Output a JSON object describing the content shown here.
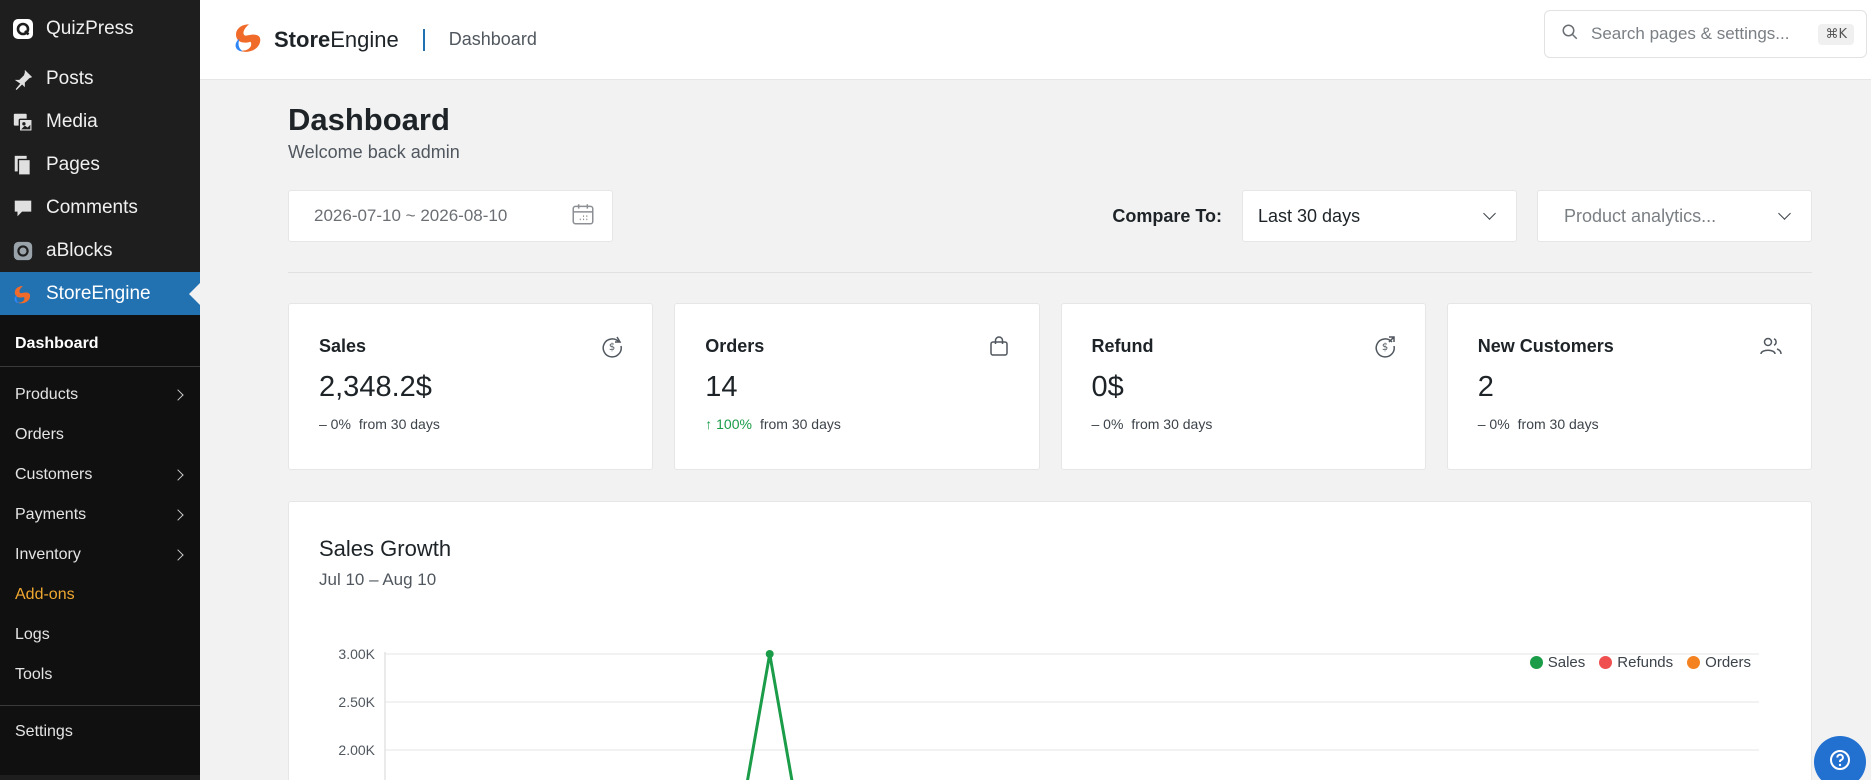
{
  "sidebar": {
    "top_items": [
      {
        "label": "QuizPress",
        "icon": "quizpress-icon"
      },
      {
        "label": "Posts",
        "icon": "pin-icon"
      },
      {
        "label": "Media",
        "icon": "media-icon"
      },
      {
        "label": "Pages",
        "icon": "pages-icon"
      },
      {
        "label": "Comments",
        "icon": "comment-icon"
      },
      {
        "label": "aBlocks",
        "icon": "ablocks-icon"
      },
      {
        "label": "StoreEngine",
        "icon": "storeengine-icon"
      }
    ],
    "submenu": [
      {
        "label": "Dashboard"
      },
      {
        "label": "Products"
      },
      {
        "label": "Orders"
      },
      {
        "label": "Customers"
      },
      {
        "label": "Payments"
      },
      {
        "label": "Inventory"
      },
      {
        "label": "Add-ons"
      },
      {
        "label": "Logs"
      },
      {
        "label": "Tools"
      },
      {
        "label": "Settings"
      }
    ]
  },
  "header": {
    "brand_bold": "Store",
    "brand_rest": "Engine",
    "crumb": "Dashboard",
    "search_placeholder": "Search pages & settings...",
    "search_shortcut": "⌘K"
  },
  "page": {
    "title": "Dashboard",
    "subtitle": "Welcome back admin"
  },
  "filters": {
    "date_range": "2026-07-10 ~ 2026-08-10",
    "compare_label": "Compare To:",
    "compare_value": "Last 30 days",
    "analytics_placeholder": "Product analytics..."
  },
  "stats": [
    {
      "title": "Sales",
      "value": "2,348.2$",
      "change": "– 0%",
      "period": "from 30 days",
      "icon": "dollar-refresh-icon"
    },
    {
      "title": "Orders",
      "value": "14",
      "change": "↑ 100%",
      "period": "from 30 days",
      "icon": "bag-icon"
    },
    {
      "title": "Refund",
      "value": "0$",
      "change": "– 0%",
      "period": "from 30 days",
      "icon": "dollar-return-icon"
    },
    {
      "title": "New Customers",
      "value": "2",
      "change": "– 0%",
      "period": "from 30 days",
      "icon": "users-icon"
    }
  ],
  "chart_card": {
    "title": "Sales Growth",
    "subtitle": "Jul 10 – Aug 10"
  },
  "chart_data": {
    "type": "line",
    "title": "Sales Growth",
    "subtitle": "Jul 10 – Aug 10",
    "ytick_labels": [
      "3.00K",
      "2.50K",
      "2.00K"
    ],
    "ylim_visible": [
      2000,
      3000
    ],
    "legend_position": "top-right",
    "grid": true,
    "series": [
      {
        "name": "Sales",
        "color": "#1a9c48",
        "peak_value": 3000,
        "peak_position_fraction": 0.28
      },
      {
        "name": "Refunds",
        "color": "#ef4f4f"
      },
      {
        "name": "Orders",
        "color": "#f58220"
      }
    ]
  },
  "colors": {
    "accent": "#2271b1",
    "sidebar_bg": "#1e1e1e",
    "addons": "#f0a830",
    "positive": "#1a9c48"
  }
}
